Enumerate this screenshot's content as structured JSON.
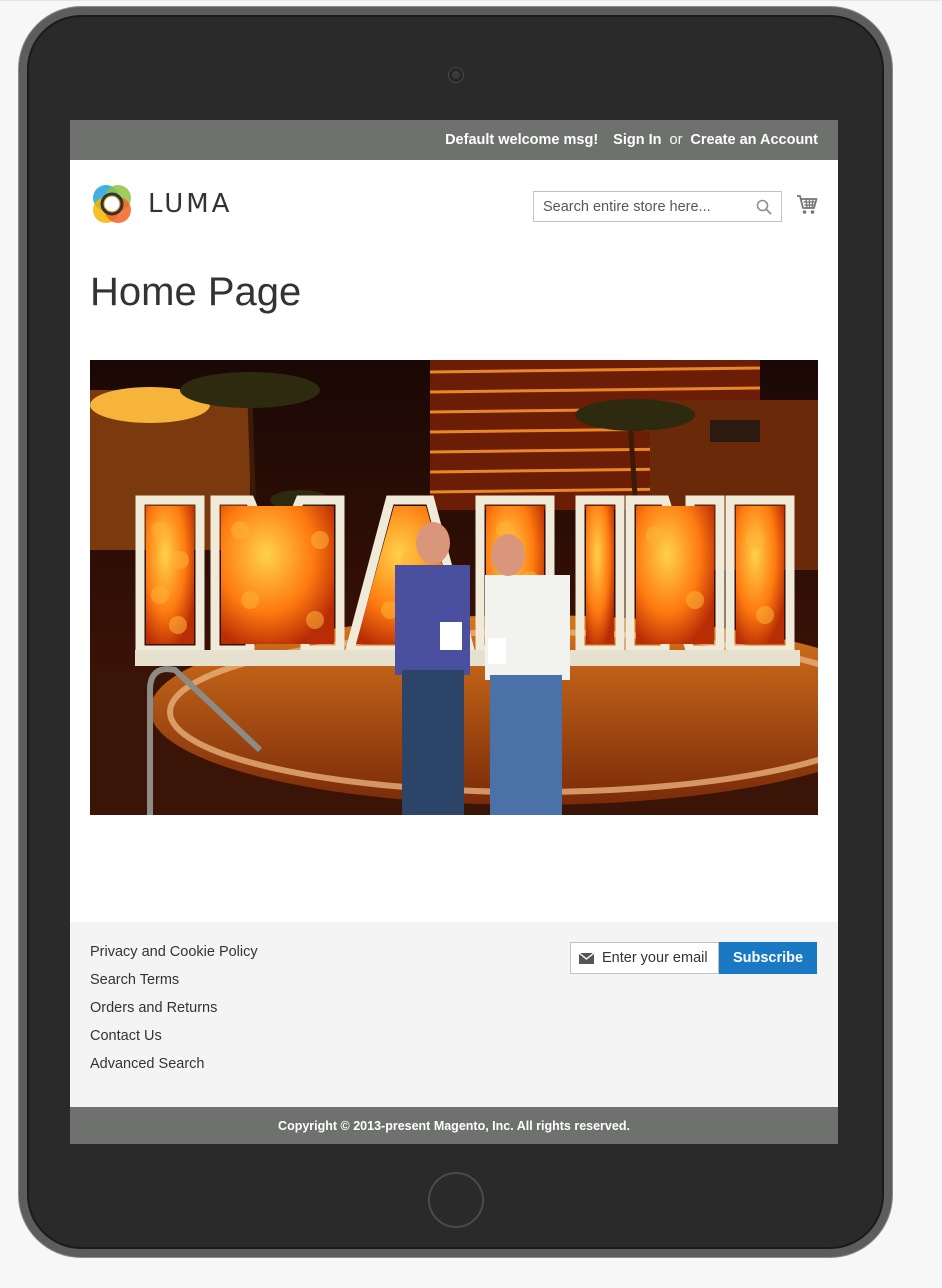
{
  "header_panel": {
    "welcome": "Default welcome msg!",
    "sign_in": "Sign In",
    "or": "or",
    "create_account": "Create an Account"
  },
  "logo": {
    "text": "LUMA"
  },
  "search": {
    "placeholder": "Search entire store here..."
  },
  "page": {
    "title": "Home Page"
  },
  "hero": {
    "sign_text": "IMAGINE"
  },
  "footer": {
    "links": [
      "Privacy and Cookie Policy",
      "Search Terms",
      "Orders and Returns",
      "Contact Us",
      "Advanced Search"
    ],
    "newsletter_placeholder": "Enter your email address",
    "subscribe_label": "Subscribe",
    "copyright": "Copyright © 2013-present Magento, Inc. All rights reserved."
  },
  "colors": {
    "panel_bg": "#6e716e",
    "accent_blue": "#1979c3",
    "footer_bg": "#f4f4f4",
    "device_body": "#2a2a2a"
  },
  "icons": [
    "luma-logo-icon",
    "search-icon",
    "cart-icon",
    "envelope-icon",
    "camera-icon",
    "home-button-icon"
  ]
}
